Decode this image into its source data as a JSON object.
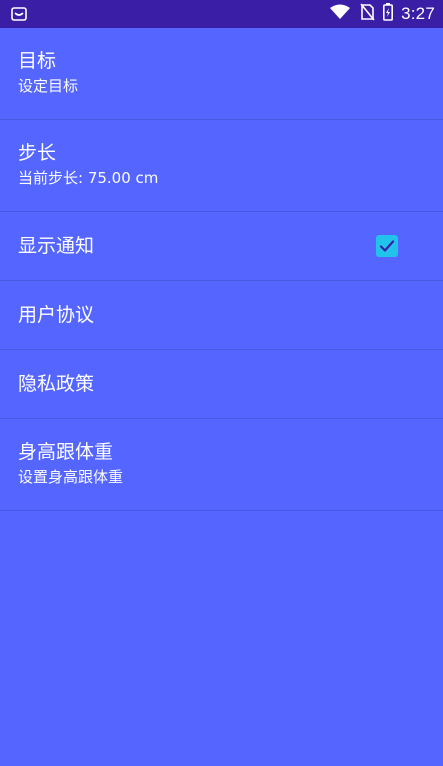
{
  "status_bar": {
    "time": "3:27",
    "icons": [
      "notification-icon",
      "wifi-icon",
      "no-sim-icon",
      "battery-icon"
    ]
  },
  "settings": {
    "items": [
      {
        "title": "目标",
        "subtitle": "设定目标"
      },
      {
        "title": "步长",
        "subtitle": "当前步长: 75.00 cm"
      },
      {
        "title": "显示通知",
        "checked": true
      },
      {
        "title": "用户协议"
      },
      {
        "title": "隐私政策"
      },
      {
        "title": "身高跟体重",
        "subtitle": "设置身高跟体重"
      }
    ]
  },
  "colors": {
    "background": "#5466ff",
    "status_bar": "#3b1ea6",
    "checkbox": "#21c3ea"
  }
}
